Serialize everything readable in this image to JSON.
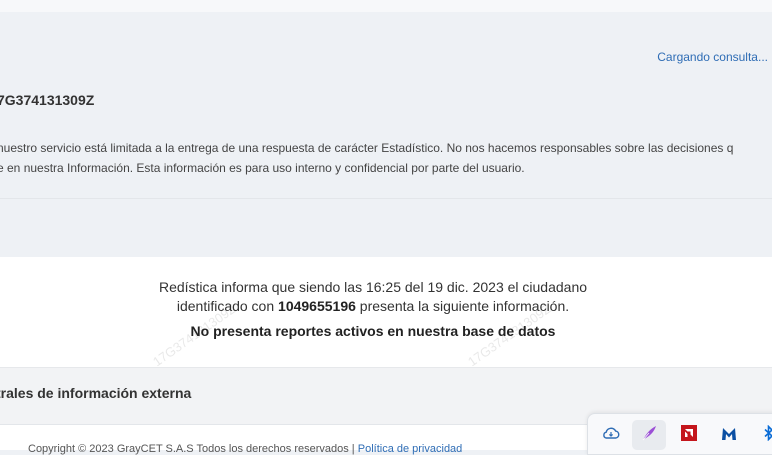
{
  "status": {
    "loading_text": "Cargando consulta..."
  },
  "query": {
    "id_text": "7G374131309Z"
  },
  "disclaimer": {
    "line1": "nuestro servicio está limitada a la entrega de una respuesta de carácter Estadístico. No nos hacemos responsables sobre las decisiones q",
    "line2": "e en nuestra Información. Esta información es para uso interno y confidencial por parte del usuario."
  },
  "result": {
    "line1": "Redística informa que siendo las 16:25 del 19 dic. 2023 el ciudadano",
    "line2_prefix": "identificado con ",
    "document_number": "1049655196",
    "line2_suffix": " presenta la siguiente información.",
    "status_text": "No presenta reportes activos en nuestra base de datos",
    "watermark_text": "17G374131309Z"
  },
  "sections": {
    "external_title": "trales de información externa"
  },
  "footer": {
    "copyright_text": "Copyright © 2023 GrayCET S.A.S Todos los derechos reservados |",
    "policy_link": "Política de privacidad"
  },
  "tray": {
    "icons": [
      "onedrive-cloud-icon",
      "feather-icon",
      "amd-icon",
      "malwarebytes-icon",
      "bluetooth-icon"
    ],
    "colors": {
      "cloud": "#2f6db5",
      "feather": "#9b4fd6",
      "amd": "#c4161c",
      "malwarebytes": "#0a4fa3",
      "bluetooth": "#0a6cd6"
    }
  }
}
